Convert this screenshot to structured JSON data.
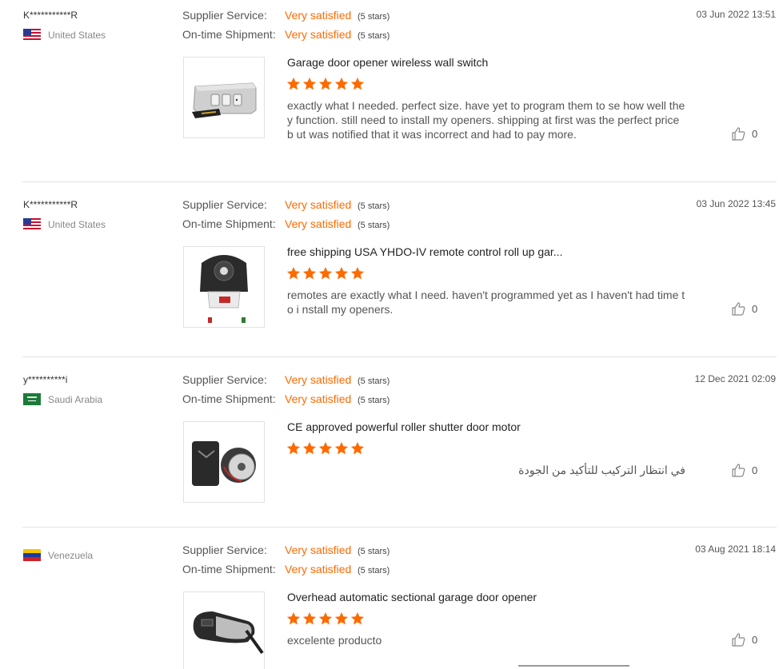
{
  "rating_labels": {
    "supplier": "Supplier Service:",
    "shipment": "On-time Shipment:"
  },
  "colors": {
    "accent": "#ff6a00",
    "star": "#ff6a00"
  },
  "reviews": [
    {
      "buyer": "K***********R",
      "country": "United States",
      "flag_icon": "us-flag-icon",
      "date": "03 Jun 2022 13:51",
      "supplier_rating": "Very satisfied",
      "supplier_stars": "(5 stars)",
      "shipment_rating": "Very satisfied",
      "shipment_stars": "(5 stars)",
      "product": "Garage door opener wireless wall switch",
      "product_image_icon": "wall-switch-icon",
      "stars": 5,
      "comment": "exactly what I needed. perfect size. have yet to program them to se how well they function.  still need to install my openers. shipping at first was the perfect price b ut was notified that it was incorrect and had to pay more.",
      "likes": "0"
    },
    {
      "buyer": "K***********R",
      "country": "United States",
      "flag_icon": "us-flag-icon",
      "date": "03 Jun 2022 13:45",
      "supplier_rating": "Very satisfied",
      "supplier_stars": "(5 stars)",
      "shipment_rating": "Very satisfied",
      "shipment_stars": "(5 stars)",
      "product": "free shipping USA YHDO-IV remote control roll up gar...",
      "product_image_icon": "roll-up-motor-icon",
      "stars": 5,
      "comment": "remotes are exactly what I need. haven't programmed yet as I haven't had time to i nstall my openers.",
      "likes": "0"
    },
    {
      "buyer": "y**********i",
      "country": "Saudi Arabia",
      "flag_icon": "saudi-flag-icon",
      "date": "12 Dec 2021 02:09",
      "supplier_rating": "Very satisfied",
      "supplier_stars": "(5 stars)",
      "shipment_rating": "Very satisfied",
      "shipment_stars": "(5 stars)",
      "product": "CE approved powerful roller shutter door motor",
      "product_image_icon": "shutter-motor-icon",
      "stars": 5,
      "comment": "في انتظار التركيب للتأكيد من الجودة",
      "likes": "0"
    },
    {
      "buyer": "",
      "country": "Venezuela",
      "flag_icon": "venezuela-flag-icon",
      "date": "03 Aug 2021 18:14",
      "supplier_rating": "Very satisfied",
      "supplier_stars": "(5 stars)",
      "shipment_rating": "Very satisfied",
      "shipment_stars": "(5 stars)",
      "product": "Overhead automatic sectional garage door opener",
      "product_image_icon": "sectional-opener-icon",
      "stars": 5,
      "comment": "excelente producto",
      "likes": "0"
    }
  ]
}
